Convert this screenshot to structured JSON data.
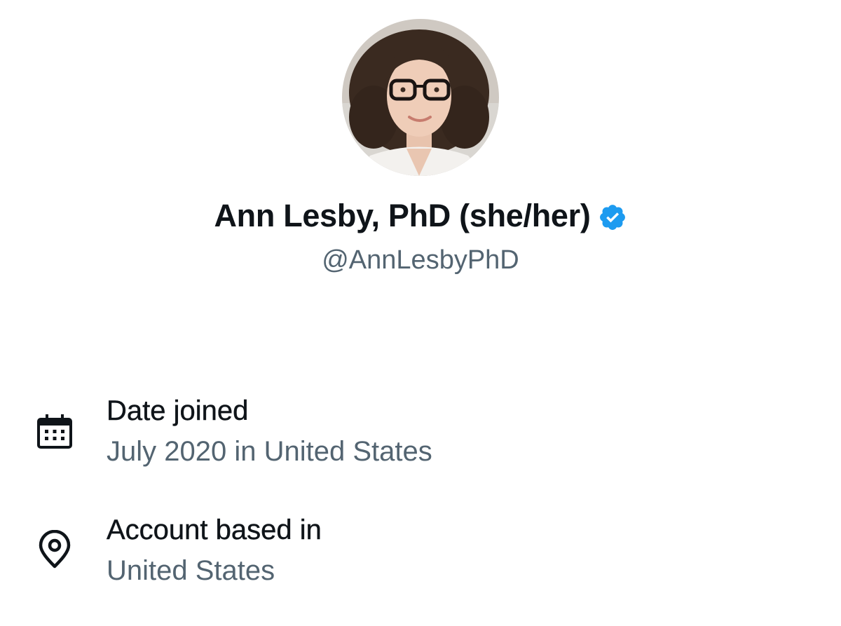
{
  "profile": {
    "display_name": "Ann Lesby, PhD (she/her)",
    "handle": "@AnnLesbyPhD",
    "verified": true,
    "avatar_icon": "profile-photo",
    "verified_icon": "verified-badge-icon"
  },
  "about": {
    "date_joined": {
      "icon": "calendar-icon",
      "title": "Date joined",
      "value": "July 2020 in United States"
    },
    "account_based_in": {
      "icon": "location-pin-icon",
      "title": "Account based in",
      "value": "United States"
    }
  },
  "colors": {
    "text_primary": "#0f1419",
    "text_secondary": "#536471",
    "verified_blue": "#1d9bf0",
    "background": "#ffffff"
  }
}
